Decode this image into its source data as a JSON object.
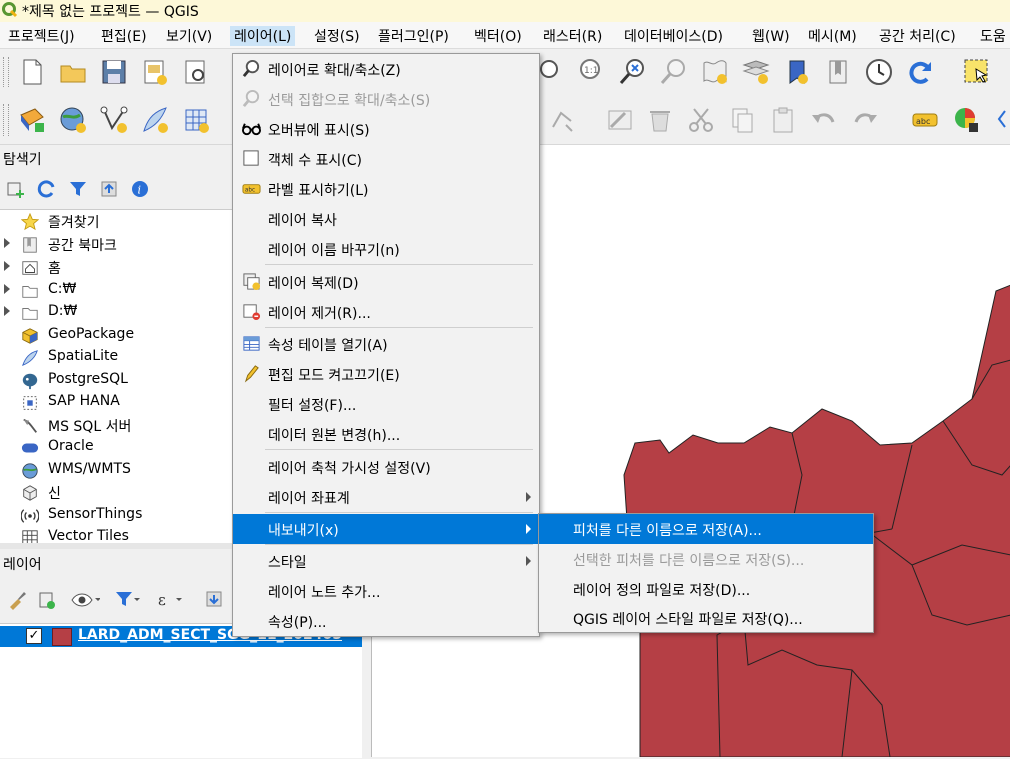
{
  "window": {
    "title": "*제목 없는 프로젝트 — QGIS"
  },
  "menubar": [
    "프로젝트(J)",
    "편집(E)",
    "보기(V)",
    "레이어(L)",
    "설정(S)",
    "플러그인(P)",
    "벡터(O)",
    "래스터(R)",
    "데이터베이스(D)",
    "웹(W)",
    "메시(M)",
    "공간 처리(C)",
    "도움"
  ],
  "browser": {
    "title": "탐색기",
    "items": [
      {
        "label": "즐겨찾기",
        "icon": "star-icon",
        "expand": false
      },
      {
        "label": "공간 북마크",
        "icon": "bookmark-icon",
        "expand": true
      },
      {
        "label": "홈",
        "icon": "home-icon",
        "expand": true
      },
      {
        "label": "C:₩",
        "icon": "folder-icon",
        "expand": true
      },
      {
        "label": "D:₩",
        "icon": "folder-icon",
        "expand": true
      },
      {
        "label": "GeoPackage",
        "icon": "geopackage-icon",
        "expand": false
      },
      {
        "label": "SpatiaLite",
        "icon": "spatialite-icon",
        "expand": false
      },
      {
        "label": "PostgreSQL",
        "icon": "postgresql-icon",
        "expand": false
      },
      {
        "label": "SAP HANA",
        "icon": "sap-hana-icon",
        "expand": false
      },
      {
        "label": "MS SQL 서버",
        "icon": "mssql-icon",
        "expand": false
      },
      {
        "label": "Oracle",
        "icon": "oracle-icon",
        "expand": false
      },
      {
        "label": "WMS/WMTS",
        "icon": "wms-globe-icon",
        "expand": false
      },
      {
        "label": "신",
        "icon": "wcs-icon",
        "expand": false
      },
      {
        "label": "SensorThings",
        "icon": "sensorthings-icon",
        "expand": false
      },
      {
        "label": "Vector Tiles",
        "icon": "vector-tiles-icon",
        "expand": false
      }
    ]
  },
  "layers": {
    "title": "레이어",
    "items": [
      {
        "name": "LARD_ADM_SECT_SGG_11_202405",
        "checked": "✓",
        "color": "#b53f45"
      }
    ]
  },
  "context_menu": {
    "items": [
      {
        "label": "레이어로 확대/축소(Z)",
        "icon": "zoom-to-layer-icon",
        "enabled": true
      },
      {
        "label": "선택 집합으로 확대/축소(S)",
        "icon": "zoom-to-selection-icon",
        "enabled": false
      },
      {
        "label": "오버뷰에 표시(S)",
        "icon": "overview-glasses-icon",
        "enabled": true
      },
      {
        "label": "객체 수 표시(C)",
        "icon": "checkbox-icon",
        "enabled": true
      },
      {
        "label": "라벨 표시하기(L)",
        "icon": "label-abc-icon",
        "enabled": true
      },
      {
        "label": "레이어 복사",
        "icon": "",
        "enabled": true
      },
      {
        "label": "레이어 이름 바꾸기(n)",
        "icon": "",
        "enabled": true
      },
      {
        "label": "레이어 복제(D)",
        "icon": "duplicate-layer-icon",
        "enabled": true
      },
      {
        "label": "레이어 제거(R)...",
        "icon": "remove-layer-icon",
        "enabled": true
      },
      {
        "label": "속성 테이블 열기(A)",
        "icon": "attribute-table-icon",
        "enabled": true
      },
      {
        "label": "편집 모드 켜고끄기(E)",
        "icon": "pencil-icon",
        "enabled": true
      },
      {
        "label": "필터 설정(F)...",
        "icon": "",
        "enabled": true
      },
      {
        "label": "데이터 원본 변경(h)...",
        "icon": "",
        "enabled": true
      },
      {
        "label": "레이어 축척 가시성 설정(V)",
        "icon": "",
        "enabled": true
      },
      {
        "label": "레이어 좌표계",
        "icon": "",
        "enabled": true,
        "submenu": true
      },
      {
        "label": "내보내기(x)",
        "icon": "",
        "enabled": true,
        "submenu": true,
        "selected": true
      },
      {
        "label": "스타일",
        "icon": "",
        "enabled": true,
        "submenu": true
      },
      {
        "label": "레이어 노트 추가...",
        "icon": "",
        "enabled": true
      },
      {
        "label": "속성(P)...",
        "icon": "",
        "enabled": true
      }
    ]
  },
  "export_submenu": {
    "items": [
      {
        "label": "피처를 다른 이름으로 저장(A)...",
        "enabled": true,
        "selected": true
      },
      {
        "label": "선택한 피처를 다른 이름으로 저장(S)...",
        "enabled": false
      },
      {
        "label": "레이어 정의 파일로 저장(D)...",
        "enabled": true
      },
      {
        "label": "QGIS 레이어 스타일 파일로 저장(Q)...",
        "enabled": true
      }
    ]
  },
  "colors": {
    "accent": "#0078d7",
    "polygon_fill": "#b53f45",
    "polygon_stroke": "#222222"
  }
}
